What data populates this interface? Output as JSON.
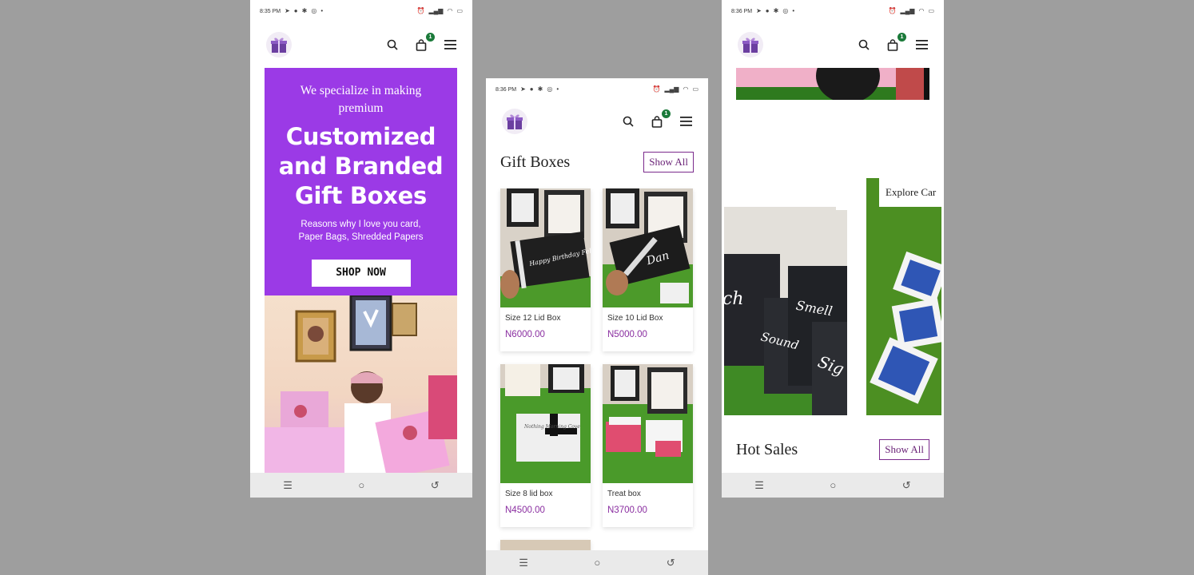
{
  "colors": {
    "brand_purple": "#9b3ae6",
    "price_purple": "#8a2ea0",
    "badge_green": "#1b7a3a",
    "background": "#9e9e9e"
  },
  "screens": [
    {
      "status": {
        "time": "8:35 PM"
      },
      "header": {
        "cart_count": "1"
      },
      "hero": {
        "intro": "We specialize in making premium",
        "title_line1": "Customized",
        "title_line2": "and Branded",
        "title_line3": "Gift Boxes",
        "sub_line1": "Reasons why I love you card,",
        "sub_line2": "Paper Bags, Shredded Papers",
        "cta": "SHOP NOW"
      }
    },
    {
      "status": {
        "time": "8:36 PM"
      },
      "header": {
        "cart_count": "1"
      },
      "section": {
        "title": "Gift Boxes",
        "show_all": "Show All"
      },
      "products": [
        {
          "name": "Size 12 Lid Box",
          "price": "N6000.00",
          "img_text": "Happy Birthday Felicity"
        },
        {
          "name": "Size 10 Lid Box",
          "price": "N5000.00",
          "img_text": "Dan"
        },
        {
          "name": "Size 8 lid box",
          "price": "N4500.00",
          "img_text": "Nothing Morning Cove"
        },
        {
          "name": "Treat box",
          "price": "N3700.00",
          "img_text": ""
        }
      ]
    },
    {
      "status": {
        "time": "8:36 PM"
      },
      "header": {
        "cart_count": "1"
      },
      "explore_label": "Explore Car",
      "bag_words": [
        "ch",
        "Smell",
        "Sound",
        "Sig"
      ],
      "section": {
        "title": "Hot Sales",
        "show_all": "Show All"
      }
    }
  ]
}
